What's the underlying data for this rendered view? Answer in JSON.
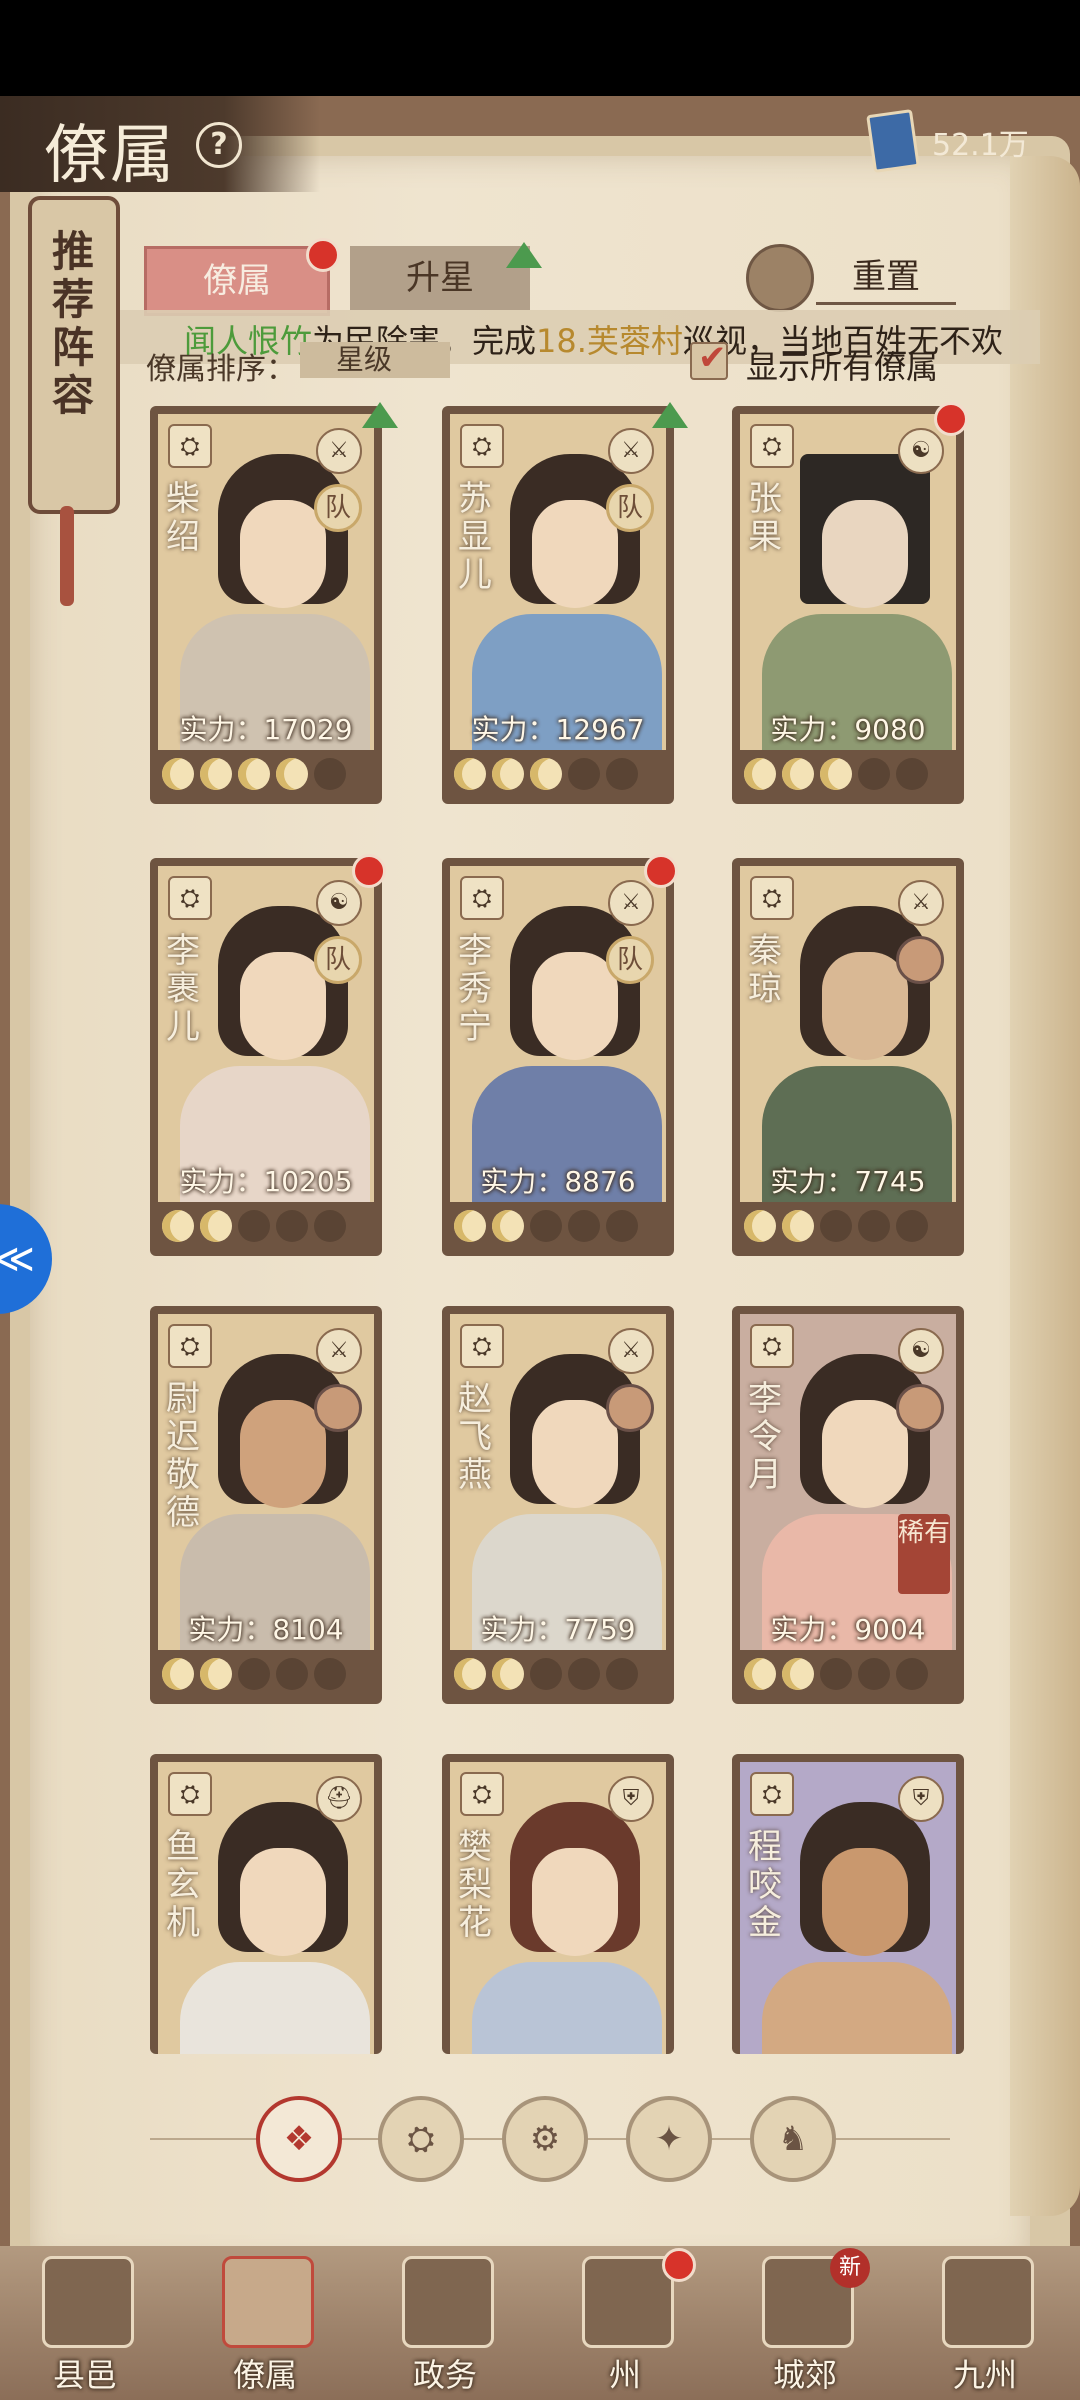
{
  "header": {
    "title": "僚属",
    "help_icon": "?",
    "resource_value": "52.1万"
  },
  "side_tab": {
    "label": "推荐阵容"
  },
  "tabs": [
    {
      "label": "僚属",
      "active": true
    },
    {
      "label": "升星",
      "active": false
    }
  ],
  "reset_label": "重置",
  "marquee": {
    "name": "闻人恨竹",
    "text1": "为民除害，完成",
    "place": "18.芙蓉村",
    "text2": "巡视，当地百姓无不欢"
  },
  "sort": {
    "label": "僚属排序：",
    "value": "星级"
  },
  "show_all": {
    "label": "显示所有僚属",
    "checked": true
  },
  "cards": [
    {
      "name": "柴绍",
      "power": "实力：17029",
      "stars": 4,
      "team": "队"
    },
    {
      "name": "苏显儿",
      "power": "实力：12967",
      "stars": 3,
      "team": "队"
    },
    {
      "name": "张果",
      "power": "实力：9080",
      "stars": 3
    },
    {
      "name": "李裹儿",
      "power": "实力：10205",
      "stars": 2,
      "team": "队"
    },
    {
      "name": "李秀宁",
      "power": "实力：8876",
      "stars": 2,
      "team": "队"
    },
    {
      "name": "秦琼",
      "power": "实力：7745",
      "stars": 2
    },
    {
      "name": "尉迟敬德",
      "power": "实力：8104",
      "stars": 2
    },
    {
      "name": "赵飞燕",
      "power": "实力：7759",
      "stars": 2
    },
    {
      "name": "李令月",
      "power": "实力：9004",
      "stars": 2,
      "rare": "稀有"
    },
    {
      "name": "鱼玄机"
    },
    {
      "name": "樊梨花"
    },
    {
      "name": "程咬金"
    }
  ],
  "nav": [
    {
      "label": "县邑"
    },
    {
      "label": "僚属",
      "active": true
    },
    {
      "label": "政务"
    },
    {
      "label": "州"
    },
    {
      "label": "城郊",
      "badge": "新"
    },
    {
      "label": "九州"
    }
  ]
}
